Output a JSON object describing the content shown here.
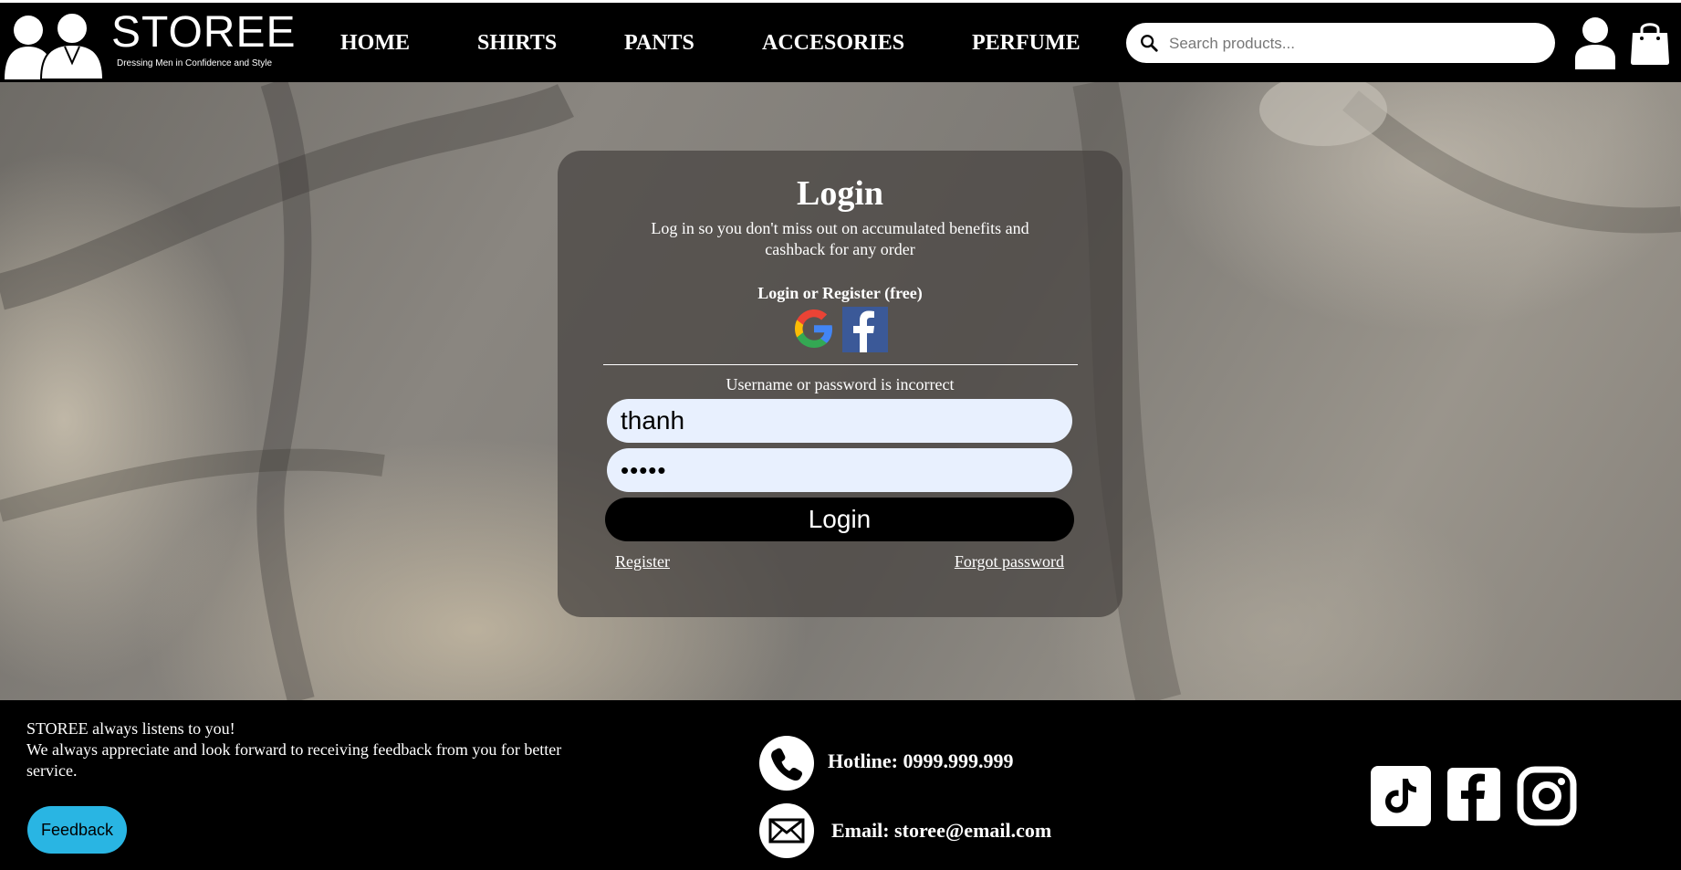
{
  "header": {
    "logo_name": "STOREE",
    "logo_tagline": "Dressing Men in Confidence and Style",
    "nav": [
      "HOME",
      "SHIRTS",
      "PANTS",
      "ACCESORIES",
      "PERFUME"
    ],
    "search_placeholder": "Search products..."
  },
  "login": {
    "title": "Login",
    "subtitle": "Log in so you don't miss out on accumulated benefits and cashback for any order",
    "social_heading": "Login or Register (free)",
    "error": "Username or password is incorrect",
    "username_value": "thanh",
    "password_value": "•••••",
    "button_label": "Login",
    "register_link": "Register",
    "forgot_link": "Forgot password"
  },
  "footer": {
    "line1": "STOREE always listens to you!",
    "line2": "We always appreciate and look forward to receiving feedback from you for better service.",
    "feedback_button": "Feedback",
    "hotline": "Hotline: 0999.999.999",
    "email": "Email: storee@email.com"
  },
  "icons": [
    "search-icon",
    "user-icon",
    "cart-icon",
    "google-icon",
    "facebook-icon",
    "phone-icon",
    "mail-icon",
    "tiktok-icon",
    "instagram-icon"
  ],
  "colors": {
    "header_bg": "#000000",
    "field_bg": "#e8f0fe",
    "feedback_button": "#29b5e3",
    "facebook_blue": "#3b5998"
  }
}
